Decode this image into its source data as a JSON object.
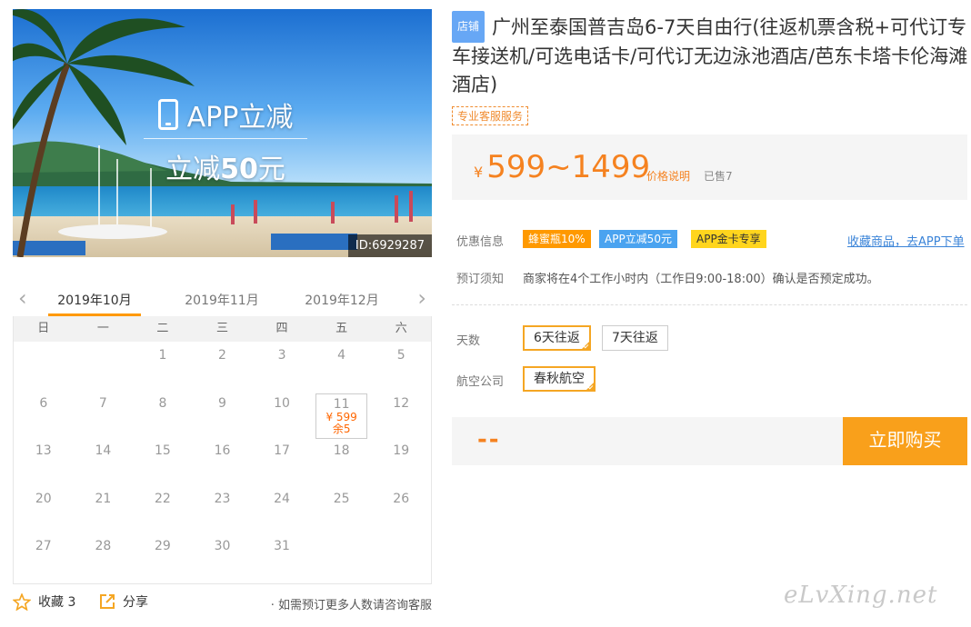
{
  "banner": {
    "line1": "APP立减",
    "line2_prefix": "立减",
    "line2_amount": "50",
    "line2_suffix": "元",
    "id_label": "ID:6929287"
  },
  "calendar": {
    "months": [
      "2019年10月",
      "2019年11月",
      "2019年12月"
    ],
    "active_month": "2019年10月",
    "weekdays": [
      "日",
      "一",
      "二",
      "三",
      "四",
      "五",
      "六"
    ],
    "leading_blanks": 2,
    "days": [
      "1",
      "2",
      "3",
      "4",
      "5",
      "6",
      "7",
      "8",
      "9",
      "10",
      "11",
      "12",
      "13",
      "14",
      "15",
      "16",
      "17",
      "18",
      "19",
      "20",
      "21",
      "22",
      "23",
      "24",
      "25",
      "26",
      "27",
      "28",
      "29",
      "30",
      "31"
    ],
    "available": {
      "day": "11",
      "price": "¥ 599",
      "stock": "余5"
    }
  },
  "footer": {
    "favorite_label": "收藏 3",
    "share_label": "分享",
    "consult_text": "· 如需预订更多人数请咨询客服"
  },
  "product": {
    "shop_tag": "店铺",
    "title": "广州至泰国普吉岛6-7天自由行(往返机票含税+可代订专车接送机/可选电话卡/可代订无边泳池酒店/芭东卡塔卡伦海滩酒店)",
    "service_tag": "专业客服服务",
    "currency": "¥",
    "price_range": "599~1499",
    "price_note": "价格说明",
    "sold": "已售7"
  },
  "promo": {
    "label": "优惠信息",
    "tags": [
      "蜂蜜瓶10%",
      "APP立减50元",
      "APP金卡专享"
    ],
    "app_link": "收藏商品，去APP下单"
  },
  "notice": {
    "label": "预订须知",
    "text": "商家将在4个工作小时内（工作日9:00-18:00）确认是否预定成功。"
  },
  "options": {
    "days_label": "天数",
    "days": [
      "6天往返",
      "7天往返"
    ],
    "airline_label": "航空公司",
    "airlines": [
      "春秋航空"
    ]
  },
  "buy": {
    "total": "--",
    "button": "立即购买"
  },
  "watermark": "eLvXing.net",
  "colors": {
    "accent_orange": "#f58220",
    "buy_button": "#f9a01b",
    "shop_tag_blue": "#67a7f5",
    "link_blue": "#3b84d8"
  }
}
